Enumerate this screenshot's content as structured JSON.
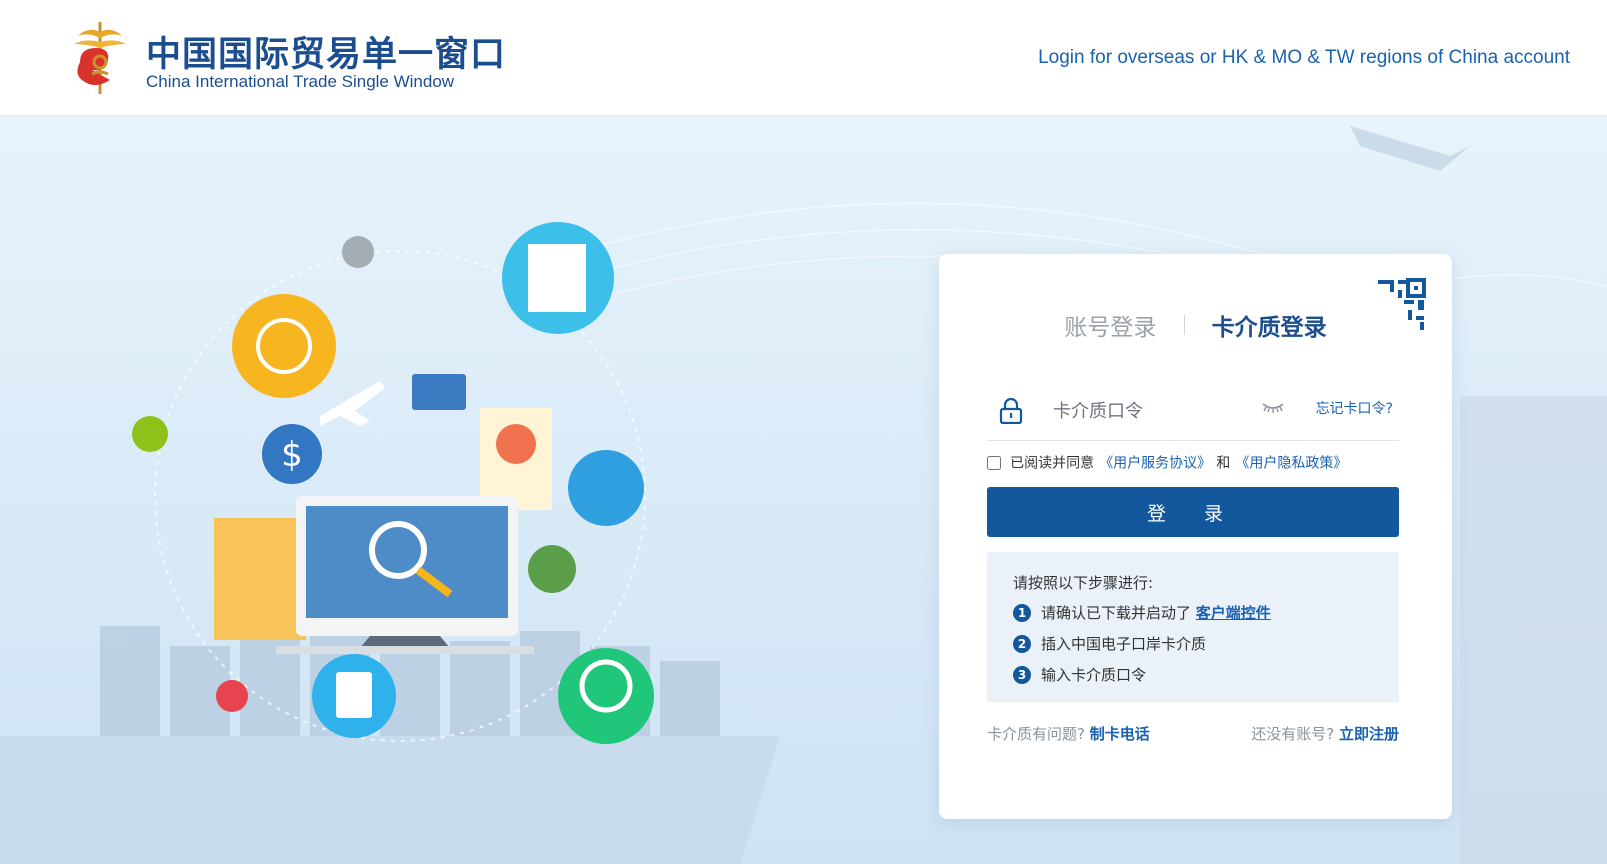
{
  "header": {
    "title_cn": "中国国际贸易单一窗口",
    "title_en": "China International Trade Single Window",
    "overseas_link": "Login for overseas or HK & MO & TW regions of China account"
  },
  "login": {
    "tabs": [
      {
        "label": "账号登录",
        "active": false
      },
      {
        "label": "卡介质登录",
        "active": true
      }
    ],
    "password_placeholder": "卡介质口令",
    "forgot_link": "忘记卡口令?",
    "agreement": {
      "text": "已阅读并同意",
      "service_link": "《用户服务协议》",
      "and": "和",
      "privacy_link": "《用户隐私政策》"
    },
    "submit_label": "登 录",
    "steps": {
      "title": "请按照以下步骤进行:",
      "items": [
        {
          "num": "1",
          "text": "请确认已下载并启动了",
          "link": "客户端控件"
        },
        {
          "num": "2",
          "text": "插入中国电子口岸卡介质",
          "link": ""
        },
        {
          "num": "3",
          "text": "输入卡介质口令",
          "link": ""
        }
      ]
    },
    "footer": {
      "card_problem": "卡介质有问题?",
      "card_phone_link": "制卡电话",
      "no_account": "还没有账号?",
      "register_link": "立即注册"
    }
  },
  "colors": {
    "primary": "#13579c",
    "link": "#1a62b0",
    "brand_text": "#1c4e8f"
  },
  "icons": [
    "emblem-logo",
    "qr-code-icon",
    "lock-icon",
    "eye-closed-icon"
  ]
}
